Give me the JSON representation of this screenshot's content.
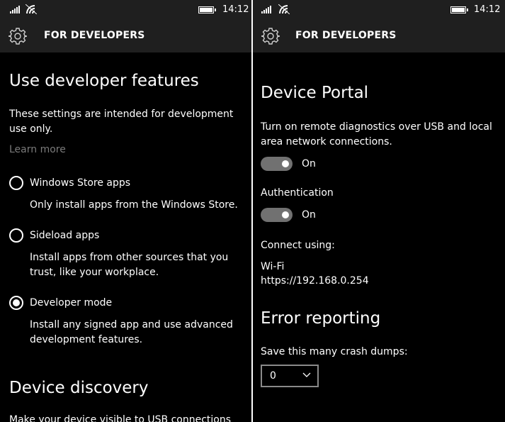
{
  "status": {
    "time": "14:12"
  },
  "header": {
    "title": "FOR DEVELOPERS"
  },
  "left": {
    "heading": "Use developer features",
    "intro_line1": "These settings are intended for development",
    "intro_line2": "use only.",
    "learn_more": "Learn more",
    "options": [
      {
        "label": "Windows Store apps",
        "desc_line1": "Only install apps from the Windows Store.",
        "desc_line2": "",
        "selected": false
      },
      {
        "label": "Sideload apps",
        "desc_line1": "Install apps from other sources that you",
        "desc_line2": "trust, like your workplace.",
        "selected": false
      },
      {
        "label": "Developer mode",
        "desc_line1": "Install any signed app and use advanced",
        "desc_line2": "development features.",
        "selected": true
      }
    ],
    "discovery_heading": "Device discovery",
    "discovery_text": "Make your device visible to USB connections"
  },
  "right": {
    "portal_heading": "Device Portal",
    "portal_desc_line1": "Turn on remote diagnostics over USB and local",
    "portal_desc_line2": "area network connections.",
    "portal_toggle": "On",
    "auth_label": "Authentication",
    "auth_toggle": "On",
    "connect_label": "Connect using:",
    "connect_type": "Wi-Fi",
    "connect_url": "https://192.168.0.254",
    "error_heading": "Error reporting",
    "crash_label": "Save this many crash dumps:",
    "crash_value": "0"
  },
  "icons": [
    "signal-icon",
    "wifi-icon",
    "battery-icon",
    "gear-icon",
    "chevron-down-icon"
  ],
  "colors": {
    "background": "#000000",
    "header": "#1f1f1f",
    "toggle_track": "#717171",
    "link": "#7a7a7a"
  }
}
